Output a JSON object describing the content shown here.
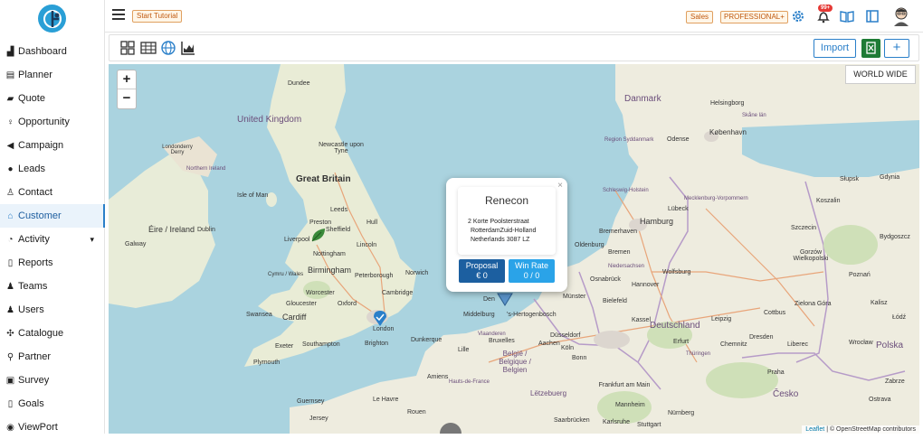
{
  "topbar": {
    "tutorial_label": "Start Tutorial",
    "sales_label": "Sales",
    "plan_label": "PROFESSIONAL+",
    "notifications_count": "99+"
  },
  "sidebar": {
    "items": [
      {
        "label": "Dashboard",
        "icon": "chart-icon"
      },
      {
        "label": "Planner",
        "icon": "list-icon"
      },
      {
        "label": "Quote",
        "icon": "bag-icon"
      },
      {
        "label": "Opportunity",
        "icon": "bulb-icon"
      },
      {
        "label": "Campaign",
        "icon": "megaphone-icon"
      },
      {
        "label": "Leads",
        "icon": "question-icon"
      },
      {
        "label": "Contact",
        "icon": "user-icon"
      },
      {
        "label": "Customer",
        "icon": "bank-icon"
      },
      {
        "label": "Activity",
        "icon": "clock-icon"
      },
      {
        "label": "Reports",
        "icon": "file-icon"
      },
      {
        "label": "Teams",
        "icon": "team-icon"
      },
      {
        "label": "Users",
        "icon": "user-plus-icon"
      },
      {
        "label": "Catalogue",
        "icon": "catalog-icon"
      },
      {
        "label": "Partner",
        "icon": "partner-icon"
      },
      {
        "label": "Survey",
        "icon": "survey-icon"
      },
      {
        "label": "Goals",
        "icon": "goal-icon"
      },
      {
        "label": "ViewPort",
        "icon": "eye-icon"
      }
    ],
    "active": "Customer"
  },
  "toolbar": {
    "import_label": "Import",
    "add_label": "+"
  },
  "map": {
    "worldwide_label": "WORLD WIDE",
    "zoom_in": "+",
    "zoom_out": "−",
    "attribution_leaflet": "Leaflet",
    "attribution_rest": " | © OpenStreetMap contributors",
    "labels": {
      "united_kingdom": "United Kingdom",
      "great_britain": "Great Britain",
      "isle_of_man": "Isle of Man",
      "eire_ireland": "Éire / Ireland",
      "dublin": "Dublin",
      "galway": "Galway",
      "dundee": "Dundee",
      "newcastle": "Newcastle upon Tyne",
      "leeds": "Leeds",
      "hull": "Hull",
      "preston": "Preston",
      "liverpool": "Liverpool",
      "sheffield": "Sheffield",
      "nottingham": "Nottingham",
      "lincoln": "Lincoln",
      "birmingham": "Birmingham",
      "peterborough": "Peterborough",
      "norwich": "Norwich",
      "cymru": "Cymru / Wales",
      "worcester": "Worcester",
      "cambridge": "Cambridge",
      "gloucester": "Gloucester",
      "oxford": "Oxford",
      "cardiff": "Cardiff",
      "swansea": "Swansea",
      "london": "London",
      "exeter": "Exeter",
      "southampton": "Southampton",
      "brighton": "Brighton",
      "plymouth": "Plymouth",
      "guernsey": "Guernsey",
      "jersey": "Jersey",
      "londonderry": "Londonderry Derry",
      "northern_ireland": "Northern Ireland",
      "danmark": "Danmark",
      "helsingborg": "Helsingborg",
      "kobenhavn": "København",
      "odense": "Odense",
      "region_syddanmark": "Region Syddanmark",
      "skane": "Skåne län",
      "hamburg": "Hamburg",
      "bremen": "Bremen",
      "bremerhaven": "Bremerhaven",
      "oldenburg": "Oldenburg",
      "lubeck": "Lübeck",
      "schleswig": "Schleswig-Holstein",
      "mecklenburg": "Mecklenburg-Vorpommern",
      "niedersachsen": "Niedersachsen",
      "hannover": "Hannover",
      "wolfsburg": "Wolfsburg",
      "osnabruck": "Osnabrück",
      "bielefeld": "Bielefeld",
      "munster": "Münster",
      "deutschland": "Deutschland",
      "leipzig": "Leipzig",
      "dusseldorf": "Düsseldorf",
      "koln": "Köln",
      "frankfurt": "Frankfurt am Main",
      "nurnberg": "Nürnberg",
      "praha": "Praha",
      "cesko": "Česko",
      "polska": "Polska",
      "szczecin": "Szczecin",
      "gdynia": "Gdynia",
      "koszalin": "Koszalin",
      "slupsk": "Słupsk",
      "bydgoszcz": "Bydgoszcz",
      "poznan": "Poznań",
      "gorzow": "Gorzów Wielkopolski",
      "zielona_gora": "Zielona Góra",
      "kalisz": "Kalisz",
      "wroclaw": "Wrocław",
      "liberec": "Liberec",
      "cottbus": "Cottbus",
      "dresden": "Dresden",
      "chemnitz": "Chemnitz",
      "erfurt": "Erfurt",
      "kassel": "Kassel",
      "thuringen": "Thüringen",
      "middelburg": "Middelburg",
      "den_haag": "Den",
      "hertogenbosch": "'s-Hertogenbosch",
      "vlaanderen": "Vlaanderen",
      "belgie": "België / Belgique / Belgien",
      "bruxelles": "Bruxelles",
      "lille": "Lille",
      "luxembourg": "Lëtzebuerg",
      "dunkerque": "Dunkerque",
      "le_havre": "Le Havre",
      "rouen": "Rouen",
      "aachen": "Aachen",
      "bonn": "Bonn",
      "mannheim": "Mannheim",
      "saarbrucken": "Saarbrücken",
      "stuttgart": "Stuttgart",
      "karlsruhe": "Karlsruhe",
      "zabrze": "Zabrze",
      "ostrava": "Ostrava",
      "amiens": "Amiens",
      "hauts_de_france": "Hauts-de-France",
      "lodz": "Łódź"
    }
  },
  "popup": {
    "name": "Renecon",
    "address_line1": "2  Korte Poolsterstraat",
    "address_line2": "RotterdamZuid-Holland",
    "address_line3": "Netherlands 3087 LZ",
    "proposal_label": "Proposal",
    "proposal_value": "€ 0",
    "winrate_label": "Win Rate",
    "winrate_value": "0 / 0",
    "close": "×"
  }
}
